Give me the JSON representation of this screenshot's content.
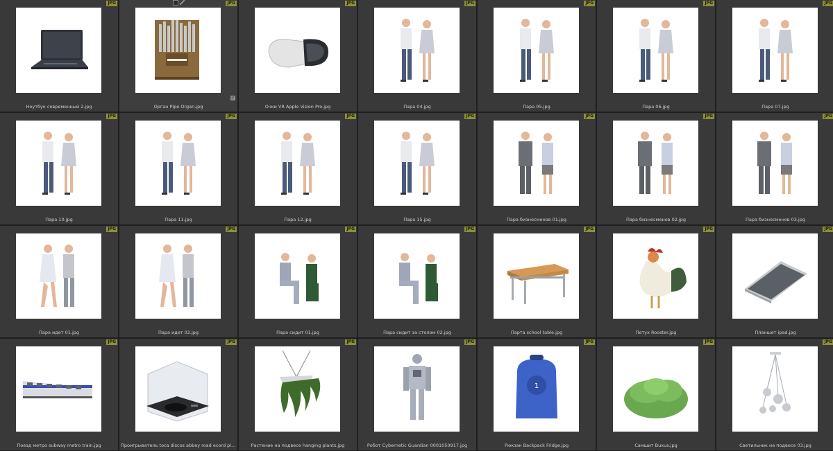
{
  "badge_text": "JPG",
  "items": [
    {
      "caption": "Ноутбук современный 2.jpg",
      "icon": "laptop-icon"
    },
    {
      "caption": "Орган Pipe Organ.jpg",
      "icon": "pipe-organ-icon",
      "selected": true
    },
    {
      "caption": "Очки VR Apple Vision Pro.jpg",
      "icon": "vr-headset-icon"
    },
    {
      "caption": "Пара 04.jpg",
      "icon": "couple-icon"
    },
    {
      "caption": "Пара 05.jpg",
      "icon": "couple-icon"
    },
    {
      "caption": "Пара 06.jpg",
      "icon": "couple-icon"
    },
    {
      "caption": "Пара 07.jpg",
      "icon": "couple-icon"
    },
    {
      "caption": "Пара 10.jpg",
      "icon": "couple-icon"
    },
    {
      "caption": "Пара 11.jpg",
      "icon": "couple-icon"
    },
    {
      "caption": "Пара 12.jpg",
      "icon": "couple-icon"
    },
    {
      "caption": "Пара 15.jpg",
      "icon": "couple-icon"
    },
    {
      "caption": "Пара бизнесменов 01.jpg",
      "icon": "business-couple-icon"
    },
    {
      "caption": "Пара бизнесменов 02.jpg",
      "icon": "business-couple-icon"
    },
    {
      "caption": "Пара бизнесменов 03.jpg",
      "icon": "business-couple-icon"
    },
    {
      "caption": "Пара идет 01.jpg",
      "icon": "walking-couple-icon"
    },
    {
      "caption": "Пара идет 02.jpg",
      "icon": "walking-couple-icon"
    },
    {
      "caption": "Пара сидит 01.jpg",
      "icon": "seated-couple-icon"
    },
    {
      "caption": "Пара сидит за столом 02.jpg",
      "icon": "seated-couple-icon"
    },
    {
      "caption": "Парта school table.jpg",
      "icon": "school-desk-icon"
    },
    {
      "caption": "Петух Rooster.jpg",
      "icon": "rooster-icon"
    },
    {
      "caption": "Планшет ipad.jpg",
      "icon": "tablet-icon"
    },
    {
      "caption": "Поезд метро subway metro train.jpg",
      "icon": "train-icon"
    },
    {
      "caption": "Проигрыватель toca discos abbey road ecord player vinyl.jpg",
      "icon": "record-player-icon"
    },
    {
      "caption": "Растение на подвесе hanging plants.jpg",
      "icon": "hanging-plant-icon"
    },
    {
      "caption": "Робот Cybernetic Guardian 0001050917.jpg",
      "icon": "robot-icon"
    },
    {
      "caption": "Рюкзак Backpack Fridge.jpg",
      "icon": "backpack-icon"
    },
    {
      "caption": "Самшит Buxus.jpg",
      "icon": "shrub-icon"
    },
    {
      "caption": "Светильник на подвесе 03.jpg",
      "icon": "pendant-lamp-icon"
    }
  ],
  "colors": {
    "background": "#1f1f1f",
    "cell": "#393939",
    "badge": "#8d8f3a",
    "caption": "#cfcfcf"
  }
}
